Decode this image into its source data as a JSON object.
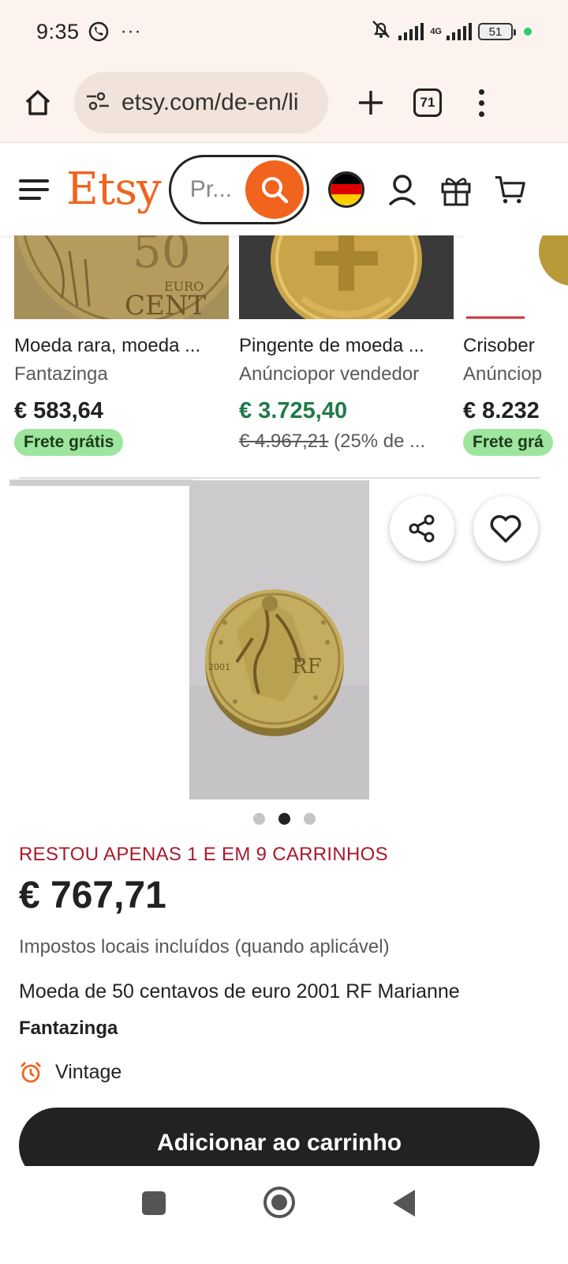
{
  "status_bar": {
    "time": "9:35",
    "more": "···",
    "network": "4G",
    "battery": "51"
  },
  "browser": {
    "url": "etsy.com/de-en/li",
    "tab_count": "71"
  },
  "header": {
    "logo": "Etsy",
    "search_placeholder": "Pr..."
  },
  "related_items": [
    {
      "title": "Moeda rara, moeda ...",
      "shop": "Fantazinga",
      "price": "€ 583,64",
      "badge": "Frete grátis"
    },
    {
      "title": "Pingente de moeda ...",
      "shop": "Anúnciopor vendedor",
      "price": "€ 3.725,40",
      "old_price": "€ 4.967,21",
      "discount": "(25% de ..."
    },
    {
      "title": "Crisober",
      "shop": "Anúnciop",
      "price": "€ 8.232",
      "badge": "Frete grá"
    }
  ],
  "product": {
    "stock_notice": "RESTOU APENAS 1 E EM 9 CARRINHOS",
    "price": "€ 767,71",
    "tax_note": "Impostos locais incluídos (quando aplicável)",
    "title": "Moeda de 50 centavos de euro 2001 RF Marianne",
    "shop": "Fantazinga",
    "condition": "Vintage",
    "image_count": 3,
    "active_image": 2,
    "coin_text": {
      "year": "2001",
      "mark": "RF"
    }
  },
  "add_to_cart_label": "Adicionar ao carrinho",
  "colors": {
    "etsy_orange": "#f1641e",
    "stock_red": "#a61a2e",
    "sale_green": "#1f7a4a",
    "badge_green": "#9ee59d"
  }
}
